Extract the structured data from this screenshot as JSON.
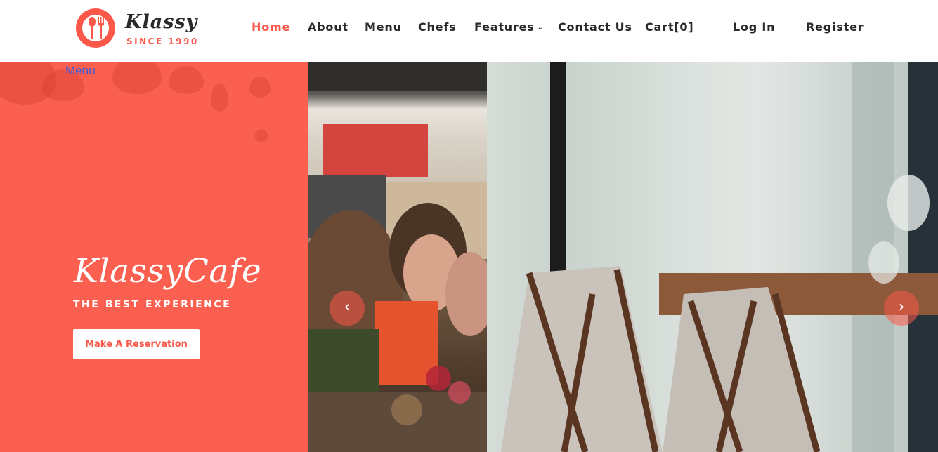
{
  "brand": {
    "name": "Klassy",
    "since": "SINCE 1990"
  },
  "nav": {
    "home": "Home",
    "about": "About",
    "menu": "Menu",
    "chefs": "Chefs",
    "features": "Features",
    "contact": "Contact Us",
    "cart": "Cart[0]",
    "login": "Log In",
    "register": "Register"
  },
  "hero": {
    "menu_link": "Menu",
    "title": "KlassyCafe",
    "tagline": "THE BEST EXPERIENCE",
    "reserve_button": "Make A Reservation",
    "prev_symbol": "‹",
    "next_symbol": "›"
  },
  "colors": {
    "accent": "#fb5849",
    "hero_panel": "#fb5f4f",
    "text_dark": "#2a2a2a",
    "link_blue": "#3b5bdb"
  },
  "icons": {
    "logo": "fork-spoon-logo-icon",
    "features_dropdown": "chevron-down-icon",
    "prev": "chevron-left-icon",
    "next": "chevron-right-icon"
  }
}
